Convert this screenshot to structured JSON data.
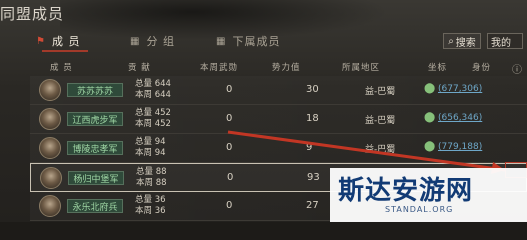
{
  "window": {
    "title": "同盟成员"
  },
  "tabs": [
    {
      "label": "成 员",
      "icon": "flag-icon"
    },
    {
      "label": "分 组",
      "icon": "grid-icon"
    },
    {
      "label": "下属成员",
      "icon": "grid-icon"
    }
  ],
  "toolbar": {
    "search_label": "搜索",
    "my_label": "我的"
  },
  "table": {
    "columns": [
      "成 员",
      "贡 献",
      "本周武勋",
      "势力值",
      "所属地区",
      "坐标",
      "身份"
    ],
    "rows": [
      {
        "name": "苏苏苏苏",
        "total": "总量 644",
        "week": "本周 644",
        "kills": "0",
        "power": "30",
        "region": "益-巴蜀",
        "coord": "(677,306)"
      },
      {
        "name": "辽西虎步军",
        "total": "总量 452",
        "week": "本周 452",
        "kills": "0",
        "power": "18",
        "region": "益-巴蜀",
        "coord": "(656,346)"
      },
      {
        "name": "博陵忠孝军",
        "total": "总量 94",
        "week": "本周 94",
        "kills": "0",
        "power": "9",
        "region": "益-巴蜀",
        "coord": "(779,188)"
      },
      {
        "name": "杨归中堡军",
        "total": "总量 88",
        "week": "本周 88",
        "kills": "0",
        "power": "93",
        "region": "",
        "coord": ""
      },
      {
        "name": "永乐北府兵",
        "total": "总量 36",
        "week": "本周 36",
        "kills": "0",
        "power": "27",
        "region": "",
        "coord": ""
      }
    ]
  },
  "watermark": {
    "main": "斯达安游网",
    "sub": "STANDAL.ORG"
  },
  "colors": {
    "accent_red": "#a23a2a",
    "name_green": "#9fd6a4",
    "coord_blue": "#6ea7c8"
  }
}
